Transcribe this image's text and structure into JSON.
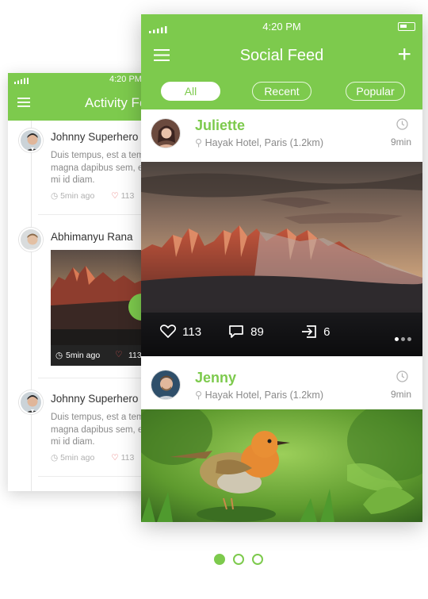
{
  "colors": {
    "accent": "#7dca4d",
    "heart": "#e05555"
  },
  "activity_feed": {
    "status_time": "4:20 PM",
    "title": "Activity Feed",
    "items": [
      {
        "name": "Johnny Superhero",
        "text": [
          "Duis tempus, est a tempus",
          "magna dapibus sem, et",
          "mi id diam."
        ],
        "time": "5min ago",
        "likes": "113"
      },
      {
        "name": "Abhimanyu Rana",
        "time": "5min ago",
        "likes": "113"
      },
      {
        "name": "Johnny Superhero",
        "text": [
          "Duis tempus, est a tempus",
          "magna dapibus sem, et",
          "mi id diam."
        ],
        "time": "5min ago",
        "likes": "113"
      }
    ]
  },
  "social_feed": {
    "status_time": "4:20 PM",
    "title": "Social Feed",
    "tabs": [
      {
        "label": "All",
        "active": true
      },
      {
        "label": "Recent",
        "active": false
      },
      {
        "label": "Popular",
        "active": false
      }
    ],
    "posts": [
      {
        "name": "Juliette",
        "location": "Hayak Hotel, Paris (1.2km)",
        "time": "9min",
        "likes": "113",
        "comments": "89",
        "shares": "6"
      },
      {
        "name": "Jenny",
        "location": "Hayak Hotel, Paris (1.2km)",
        "time": "9min"
      }
    ]
  },
  "pagination": {
    "pages": 3,
    "current": 1
  }
}
